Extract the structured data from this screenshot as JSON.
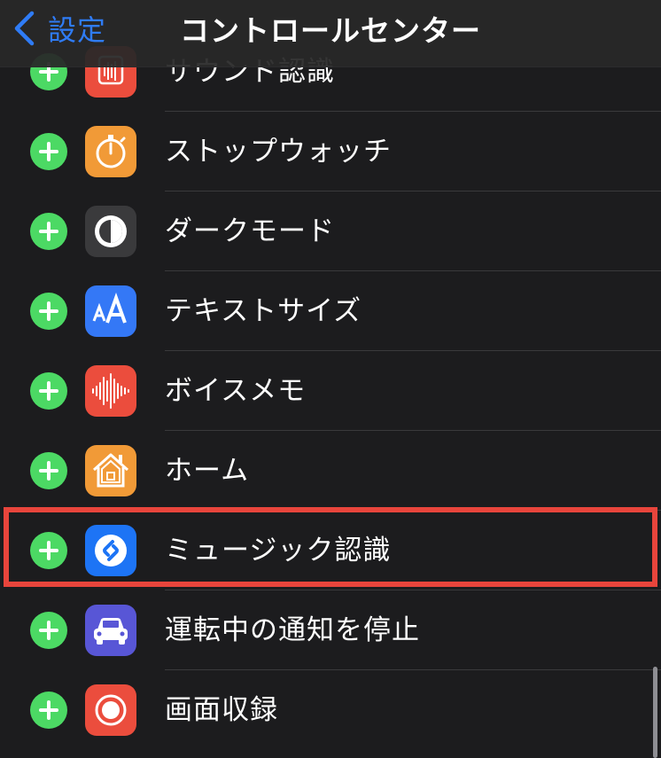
{
  "nav": {
    "back_label": "設定",
    "title": "コントロールセンター"
  },
  "items": [
    {
      "label": "サウンド認識",
      "icon": "sound-recognition-icon",
      "color": "#eb4d3d"
    },
    {
      "label": "ストップウォッチ",
      "icon": "stopwatch-icon",
      "color": "#f19a37"
    },
    {
      "label": "ダークモード",
      "icon": "dark-mode-icon",
      "color": "#3a3a3c"
    },
    {
      "label": "テキストサイズ",
      "icon": "text-size-icon",
      "color": "#3478f6"
    },
    {
      "label": "ボイスメモ",
      "icon": "voice-memo-icon",
      "color": "#eb4d3d"
    },
    {
      "label": "ホーム",
      "icon": "home-icon",
      "color": "#f19a37"
    },
    {
      "label": "ミュージック認識",
      "icon": "shazam-icon",
      "color": "#1d74f5"
    },
    {
      "label": "運転中の通知を停止",
      "icon": "car-icon",
      "color": "#5856d6"
    },
    {
      "label": "画面収録",
      "icon": "screen-record-icon",
      "color": "#eb4d3d"
    }
  ],
  "colors": {
    "background": "#1c1c1e",
    "add_button": "#4cd964",
    "accent": "#2f7cf6",
    "highlight": "#e8453c"
  }
}
